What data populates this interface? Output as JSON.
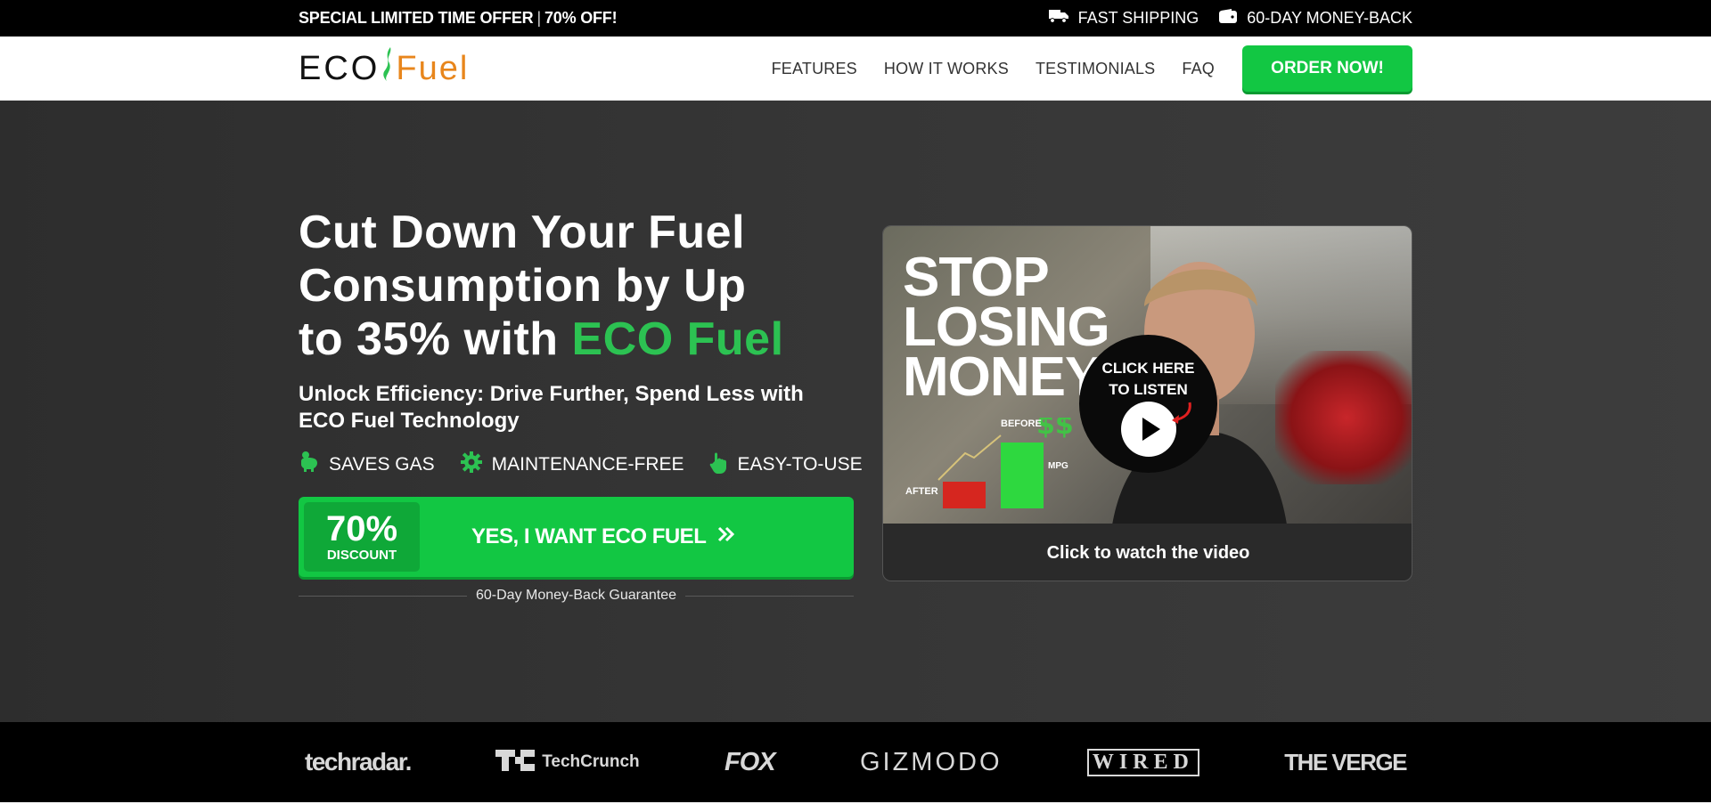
{
  "topbar": {
    "offer_part1": "SPECIAL LIMITED TIME OFFER",
    "offer_sep": "|",
    "offer_part2": "70% OFF!",
    "shipping": "FAST SHIPPING",
    "moneyback": "60-DAY MONEY-BACK"
  },
  "header": {
    "logo_eco": "ECO",
    "logo_fuel": "Fuel",
    "nav": [
      "FEATURES",
      "HOW IT WORKS",
      "TESTIMONIALS",
      "FAQ"
    ],
    "order_label": "ORDER NOW!"
  },
  "hero": {
    "headline_line1": "Cut Down Your Fuel",
    "headline_line2": "Consumption by Up",
    "headline_line3_pre": "to 35% with",
    "headline_brand": "ECO Fuel",
    "subhead": "Unlock Efficiency: Drive Further, Spend Less with ECO Fuel Technology",
    "features": [
      "SAVES GAS",
      "MAINTENANCE-FREE",
      "EASY-TO-USE"
    ],
    "cta": {
      "discount_pct": "70%",
      "discount_label": "DISCOUNT",
      "label": "YES, I WANT ECO FUEL"
    },
    "guarantee": "60-Day Money-Back Guarantee"
  },
  "video": {
    "stop_line1": "STOP",
    "stop_line2": "LOSING",
    "stop_line3": "MONEY",
    "listen_line1": "CLICK HERE",
    "listen_line2": "TO LISTEN",
    "chart_before": "BEFORE",
    "chart_after": "AFTER",
    "chart_mpg": "MPG",
    "watch_label": "Click to watch the video"
  },
  "press": [
    "techradar.",
    "TechCrunch",
    "FOX",
    "GIZMODO",
    "WIRED",
    "THE VERGE"
  ],
  "colors": {
    "accent_green": "#12c743",
    "brand_green_text": "#2cc252",
    "logo_orange": "#e8861c"
  }
}
